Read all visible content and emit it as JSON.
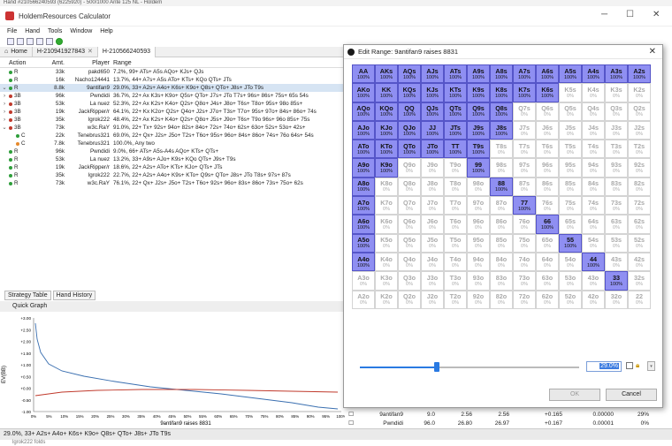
{
  "top_strip": "Hand #210566240593 (6225920) - 500/1000 Ante 125 NL - Holdem",
  "window": {
    "title": "HoldemResources Calculator"
  },
  "menu": [
    "File",
    "Hand",
    "Tools",
    "Window",
    "Help"
  ],
  "tabs": [
    "Home",
    "H-210941927843",
    "H-210566240593"
  ],
  "columns": {
    "action": "Action",
    "amt": "Amt.",
    "player": "Player",
    "range": "Range"
  },
  "rows": [
    {
      "exp": "",
      "act": "R",
      "color": "#2e9e3a",
      "amt": "33k",
      "player": "pakd650",
      "range": "7.2%, 99+ ATs+ A5s AQo+ KJs+ QJs",
      "sel": false
    },
    {
      "exp": "",
      "act": "R",
      "color": "#2e9e3a",
      "amt": "16k",
      "player": "Nacho124441",
      "range": "13.7%, 44+ A7s+ A5s ATo+ KTs+ KQo QTs+ JTs",
      "sel": false
    },
    {
      "exp": "⌄",
      "act": "R",
      "color": "#2e9e3a",
      "amt": "8.8k",
      "player": "9antifan9",
      "range": "29.0%, 33+ A2s+ A4o+ K6s+ K9o+ Q8s+ QTo+ J8s+ JTo T9s",
      "sel": true
    },
    {
      "exp": "›",
      "act": "3B",
      "color": "#c0392b",
      "amt": "96k",
      "player": "Pwndidi",
      "range": "36.7%, 22+ Ax K3s+ K9o+ Q5s+ QTo+ J7s+ JTo T7s+ 96s+ 86s+ 75s+ 65s 54s",
      "sel": false
    },
    {
      "exp": "›",
      "act": "3B",
      "color": "#c0392b",
      "amt": "53k",
      "player": "La nuez",
      "range": "52.3%, 22+ Ax K2s+ K4o+ Q2s+ Q8o+ J4s+ J8o+ T6s+ T8o+ 95s+ 98o 85s+",
      "sel": false
    },
    {
      "exp": "›",
      "act": "3B",
      "color": "#c0392b",
      "amt": "19k",
      "player": "JackRipper/r",
      "range": "64.1%, 22+ Kx K2o+ Q2s+ Q4o+ J2s+ J7o+ T3s+ T7o+ 95s+ 97o+ 84s+ 86o+ 74s",
      "sel": false
    },
    {
      "exp": "›",
      "act": "3B",
      "color": "#c0392b",
      "amt": "35k",
      "player": "lgrok222",
      "range": "48.4%, 22+ Ax K2s+ K4o+ Q2s+ Q8o+ J5s+ J9o+ T6s+ T9o 96s+ 96o 85s+ 75s",
      "sel": false
    },
    {
      "exp": "⌄",
      "act": "3B",
      "color": "#c0392b",
      "amt": "73k",
      "player": "w3c.RaY",
      "range": "91.0%, 22+ Tx+ 92s+ 94o+ 82s+ 84o+ 72s+ 74o+ 62s+ 63o+ 52s+ 53o+ 42s+",
      "sel": false
    },
    {
      "exp": "",
      "act": "C",
      "color": "#2e9e3a",
      "amt": "22k",
      "player": "Tenebrus321",
      "range": "69.0%, 22+ Qx+ J2s+ J5o+ T2s+ T6o+ 95s+ 96o+ 84s+ 86o+ 74s+ 76o 64s+ 54s",
      "sel": false,
      "indent": true
    },
    {
      "exp": "",
      "act": "C",
      "color": "#e6892b",
      "amt": "7.8k",
      "player": "Tenebrus321",
      "range": "100.0%, Any two",
      "sel": false,
      "indent": true
    },
    {
      "exp": "",
      "act": "R",
      "color": "#2e9e3a",
      "amt": "96k",
      "player": "Pwndidi",
      "range": "9.0%, 66+ ATs+ A5s-A4s AQo+ KTs+ QTs+",
      "sel": false
    },
    {
      "exp": "",
      "act": "R",
      "color": "#2e9e3a",
      "amt": "53k",
      "player": "La nuez",
      "range": "13.2%, 33+ A9s+ AJo+ K9s+ KQo QTs+ J9s+ T9s",
      "sel": false
    },
    {
      "exp": "",
      "act": "R",
      "color": "#2e9e3a",
      "amt": "19k",
      "player": "JackRipper/r",
      "range": "18.6%, 22+ A2s+ ATo+ KTs+ KJo+ QTs+ JTs",
      "sel": false
    },
    {
      "exp": "",
      "act": "R",
      "color": "#2e9e3a",
      "amt": "35k",
      "player": "lgrok222",
      "range": "22.7%, 22+ A2s+ A4o+ K9s+ KTo+ Q9s+ QTo+ J8s+ JTo T8s+ 97s+ 87s",
      "sel": false
    },
    {
      "exp": "",
      "act": "R",
      "color": "#2e9e3a",
      "amt": "73k",
      "player": "w3c.RaY",
      "range": "76.1%, 22+ Qx+ J2s+ J5o+ T2s+ T6o+ 92s+ 96o+ 83s+ 86o+ 73s+ 75o+ 62s",
      "sel": false
    }
  ],
  "panel_tabs": [
    "Strategy Table",
    "Hand History"
  ],
  "quick_graph": {
    "title": "Quick Graph",
    "ylabel": "EV(BB)",
    "xlabel": "9antifan9 raises 8831"
  },
  "status_bar": "29.0%, 33+ A2s+ A4o+ K6s+ K9o+ Q8s+ QTo+ J8s+ JTo T9s",
  "status_sub": "lgrok222 folds",
  "bottom_table": [
    {
      "name": "9antifan9",
      "a": "9.0",
      "b": "2.56",
      "c": "2.56",
      "d": "+0.165",
      "e": "0.00000",
      "f": "29%"
    },
    {
      "name": "Pwndidi",
      "a": "96.0",
      "b": "26.80",
      "c": "26.97",
      "d": "+0.167",
      "e": "0.00001",
      "f": "0%"
    }
  ],
  "dialog": {
    "title": "Edit Range: 9antifan9 raises 8831",
    "percent": "29.0%",
    "ok_label": "OK",
    "cancel_label": "Cancel"
  },
  "range_grid": {
    "ranks": [
      "A",
      "K",
      "Q",
      "J",
      "T",
      "9",
      "8",
      "7",
      "6",
      "5",
      "4",
      "3",
      "2"
    ],
    "selected": [
      [
        1,
        1,
        1,
        1,
        1,
        1,
        1,
        1,
        1,
        1,
        1,
        1,
        1
      ],
      [
        1,
        1,
        1,
        1,
        1,
        1,
        1,
        1,
        1,
        0,
        0,
        0,
        0
      ],
      [
        1,
        1,
        1,
        1,
        1,
        1,
        1,
        0,
        0,
        0,
        0,
        0,
        0
      ],
      [
        1,
        1,
        1,
        1,
        1,
        1,
        1,
        0,
        0,
        0,
        0,
        0,
        0
      ],
      [
        1,
        1,
        1,
        1,
        1,
        1,
        0,
        0,
        0,
        0,
        0,
        0,
        0
      ],
      [
        1,
        1,
        0,
        0,
        0,
        1,
        0,
        0,
        0,
        0,
        0,
        0,
        0
      ],
      [
        1,
        0,
        0,
        0,
        0,
        0,
        1,
        0,
        0,
        0,
        0,
        0,
        0
      ],
      [
        1,
        0,
        0,
        0,
        0,
        0,
        0,
        1,
        0,
        0,
        0,
        0,
        0
      ],
      [
        1,
        0,
        0,
        0,
        0,
        0,
        0,
        0,
        1,
        0,
        0,
        0,
        0
      ],
      [
        1,
        0,
        0,
        0,
        0,
        0,
        0,
        0,
        0,
        1,
        0,
        0,
        0
      ],
      [
        1,
        0,
        0,
        0,
        0,
        0,
        0,
        0,
        0,
        0,
        1,
        0,
        0
      ],
      [
        0,
        0,
        0,
        0,
        0,
        0,
        0,
        0,
        0,
        0,
        0,
        1,
        0
      ],
      [
        0,
        0,
        0,
        0,
        0,
        0,
        0,
        0,
        0,
        0,
        0,
        0,
        0
      ]
    ]
  },
  "graph_axis": {
    "y_ticks": [
      "+3.00",
      "+2.50",
      "+2.00",
      "+1.50",
      "+1.00",
      "+0.50",
      "+0.00",
      "-0.50",
      "-1.00"
    ],
    "x_ticks": [
      "0%",
      "5%",
      "10%",
      "15%",
      "20%",
      "25%",
      "30%",
      "35%",
      "40%",
      "45%",
      "50%",
      "55%",
      "60%",
      "65%",
      "70%",
      "75%",
      "80%",
      "85%",
      "90%",
      "95%",
      "100%"
    ]
  }
}
